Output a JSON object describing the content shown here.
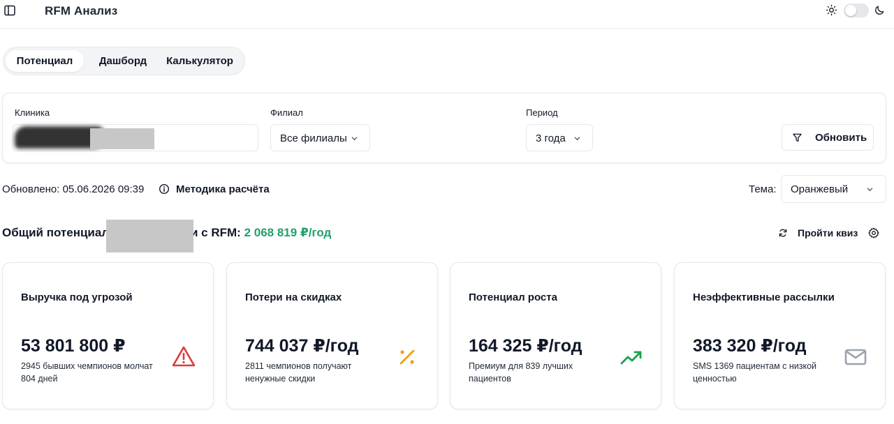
{
  "app": {
    "title": "RFM Анализ"
  },
  "tabs": [
    {
      "label": "Потенциал",
      "active": true
    },
    {
      "label": "Дашборд",
      "active": false
    },
    {
      "label": "Калькулятор",
      "active": false
    }
  ],
  "filters": {
    "clinic": {
      "label": "Клиника",
      "value": ""
    },
    "branch": {
      "label": "Филиал",
      "value": "Все филиалы"
    },
    "period": {
      "label": "Период",
      "value": "3 года"
    },
    "refresh_label": "Обновить"
  },
  "info": {
    "updated_prefix": "Обновлено:",
    "updated_value": "05.06.2026 09:39",
    "method_label": "Методика расчёта",
    "theme_label": "Тема:",
    "theme_value": "Оранжевый"
  },
  "headline": {
    "prefix": "Общий потенциал",
    "suffix": "и с RFM:",
    "value": "2 068 819 ₽/год",
    "value_color": "#22a06b"
  },
  "actions": {
    "quiz_label": "Пройти квиз"
  },
  "cards": [
    {
      "title": "Выручка под угрозой",
      "value": "53 801 800 ₽",
      "description": "2945 бывших чемпионов молчат 804 дней",
      "icon": "warning-triangle-icon",
      "icon_color": "#dc3b3b"
    },
    {
      "title": "Потери на скидках",
      "value": "744 037 ₽/год",
      "description": "2811 чемпионов получают ненужные скидки",
      "icon": "percent-icon",
      "icon_color": "#f59e0b"
    },
    {
      "title": "Потенциал роста",
      "value": "164 325 ₽/год",
      "description": "Премиум для 839 лучших пациентов",
      "icon": "trending-up-icon",
      "icon_color": "#16a34a"
    },
    {
      "title": "Неэффективные рассылки",
      "value": "383 320 ₽/год",
      "description": "SMS 1369 пациентам с низкой ценностью",
      "icon": "mail-icon",
      "icon_color": "#9aa3ad"
    }
  ]
}
